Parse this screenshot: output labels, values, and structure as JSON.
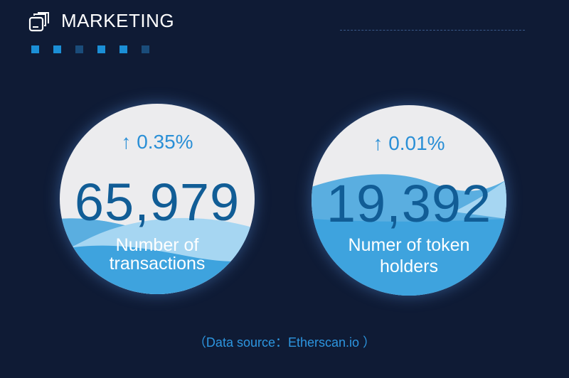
{
  "header": {
    "title": "MARKETING",
    "icon": "stacked-windows-icon"
  },
  "colors": {
    "bg": "#0f1b35",
    "accent": "#2a8fd6",
    "number": "#115d96",
    "dots": [
      "#1b8fd6",
      "#1b8fd6",
      "#1a4c7a",
      "#1b8fd6",
      "#1b8fd6",
      "#1a4c7a"
    ]
  },
  "stats": [
    {
      "change": "0.35%",
      "value": "65,979",
      "label_line1": "Number of",
      "label_line2": "transactions"
    },
    {
      "change": "0.01%",
      "value": "19,392",
      "label_line1": "Numer of token",
      "label_line2": "holders"
    }
  ],
  "source": "（Data source：Etherscan.io ）"
}
